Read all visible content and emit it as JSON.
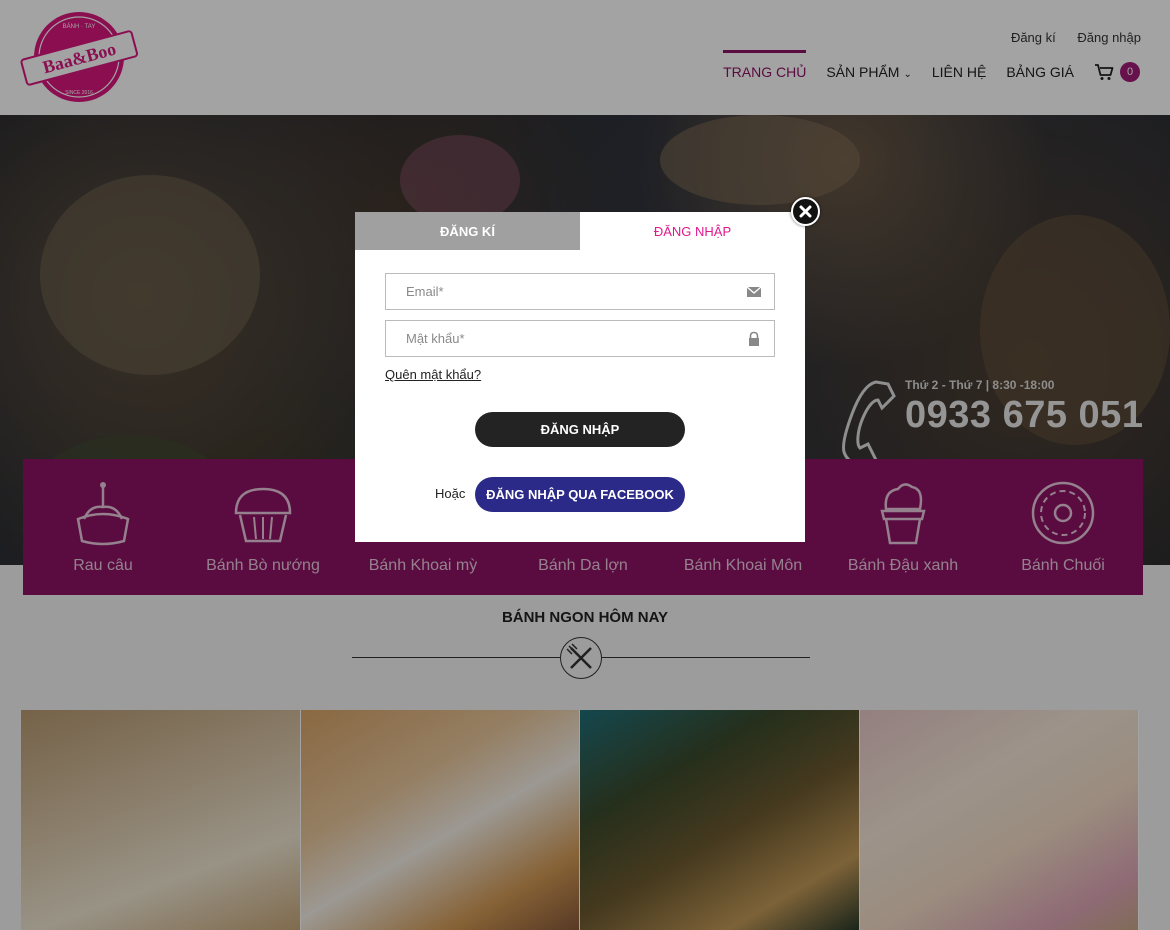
{
  "brand": {
    "logo_text": "Baa&Boo",
    "logo_top_text": "BÁNH · TAY",
    "logo_bottom_text": "SINCE 2016",
    "accent_color": "#8d1365",
    "pink_color": "#e0198e"
  },
  "top_links": {
    "register": "Đăng kí",
    "login": "Đăng nhập"
  },
  "nav": {
    "items": [
      {
        "label": "TRANG CHỦ",
        "active": true
      },
      {
        "label": "SẢN PHẨM",
        "dropdown": true
      },
      {
        "label": "LIÊN HỆ"
      },
      {
        "label": "BẢNG GIÁ"
      }
    ],
    "cart_count": "0"
  },
  "hero": {
    "hours": "Thứ 2 - Thứ 7 | 8:30 -18:00",
    "phone": "0933 675 051"
  },
  "categories": [
    {
      "label": "Rau câu",
      "icon": "cake-icon"
    },
    {
      "label": "Bánh Bò nướng",
      "icon": "muffin-icon"
    },
    {
      "label": "Bánh Khoai mỳ",
      "icon": "dessert-icon"
    },
    {
      "label": "Bánh Da lợn",
      "icon": "layer-cake-icon"
    },
    {
      "label": "Bánh Khoai Môn",
      "icon": "pie-icon"
    },
    {
      "label": "Bánh Đậu xanh",
      "icon": "cupcake-icon"
    },
    {
      "label": "Bánh Chuối",
      "icon": "donut-icon"
    }
  ],
  "section": {
    "title": "BÁNH NGON HÔM NAY"
  },
  "modal": {
    "tab_register": "ĐĂNG KÍ",
    "tab_login": "ĐĂNG NHẬP",
    "email_placeholder": "Email*",
    "password_placeholder": "Mật khẩu*",
    "forgot": "Quên mật khẩu?",
    "login_button": "ĐĂNG NHẬP",
    "or": "Hoặc",
    "facebook_button": "ĐĂNG NHẬP QUA FACEBOOK"
  }
}
